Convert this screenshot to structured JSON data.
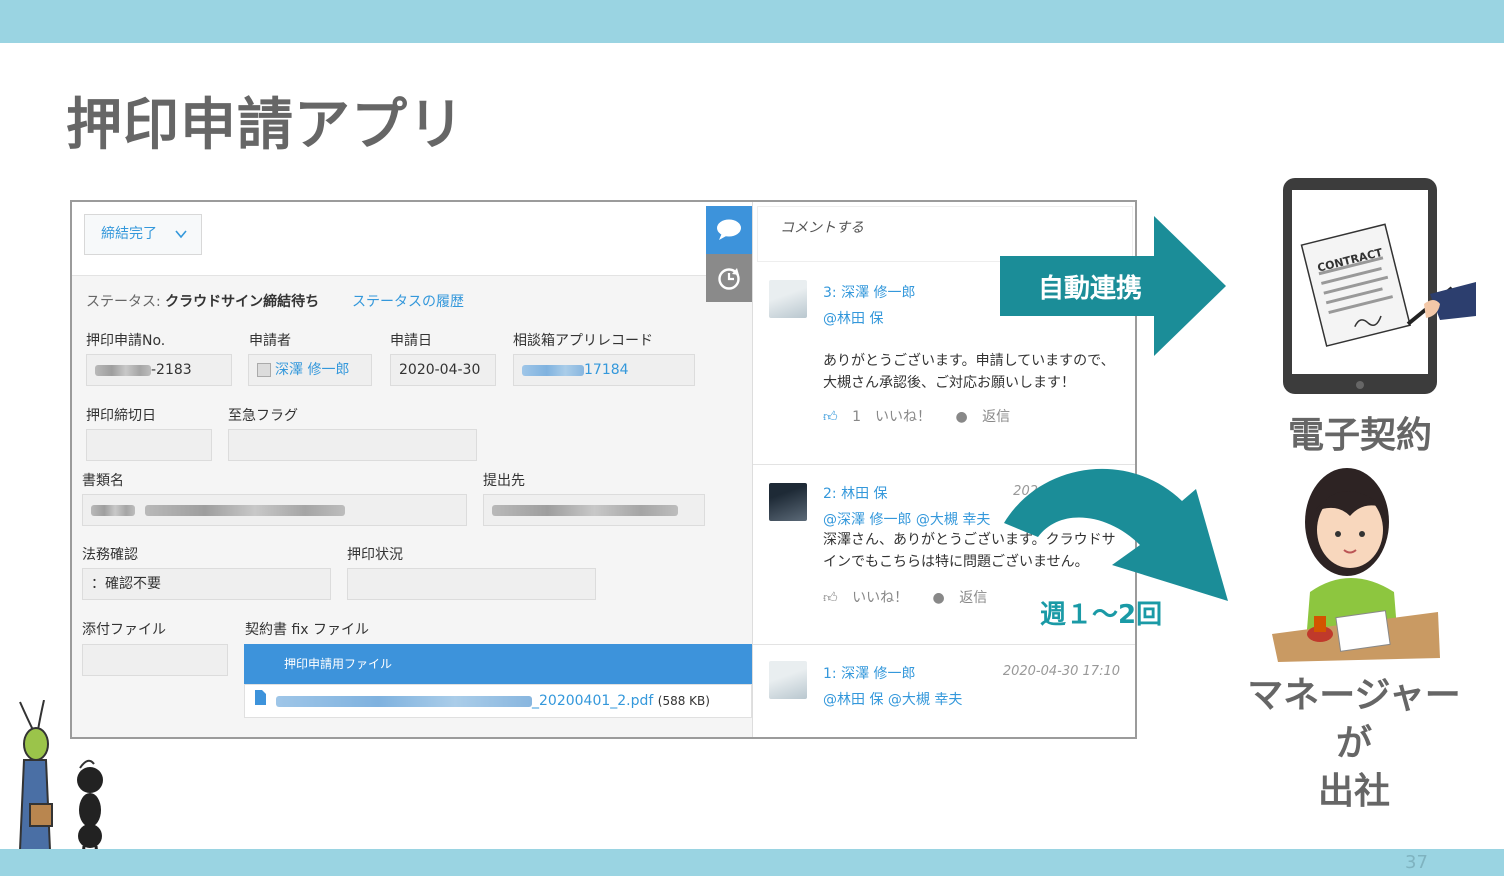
{
  "slide": {
    "title": "押印申請アプリ",
    "page_number": "37"
  },
  "colors": {
    "band": "#9ad4e2",
    "teal": "#1b8d98",
    "link": "#3498db",
    "file_header": "#3d93db"
  },
  "record": {
    "action_button": "締結完了",
    "action_chevron_icon": "chevron-down-icon",
    "status_label": "ステータス: ",
    "status_value": "クラウドサイン締結待ち",
    "status_history_link": "ステータスの履歴",
    "fields": {
      "request_no_label": "押印申請No.",
      "request_no_value": "-2183",
      "applicant_label": "申請者",
      "applicant_value": "深澤 修一郎",
      "apply_date_label": "申請日",
      "apply_date_value": "2020-04-30",
      "consult_record_label": "相談箱アプリレコード",
      "consult_record_value": "17184",
      "deadline_label": "押印締切日",
      "urgent_label": "至急フラグ",
      "doc_name_label": "書類名",
      "submit_to_label": "提出先",
      "legal_label": "法務確認",
      "legal_value": "：確認不要",
      "stamp_status_label": "押印状況",
      "attachment_label": "添付ファイル",
      "contract_fix_label": "契約書 fix ファイル"
    },
    "file_table": {
      "header": "押印申請用ファイル",
      "file_name_suffix": "_20200401_2.pdf",
      "file_size": "(588 KB)"
    }
  },
  "side_tabs": [
    {
      "icon": "comment-icon",
      "active": true
    },
    {
      "icon": "history-icon",
      "active": false
    }
  ],
  "comments": {
    "input_placeholder": "コメントする",
    "items": [
      {
        "name": "3: 深澤 修一郎",
        "mention": "@林田 保",
        "body": "ありがとうございます。申請していますので、大槻さん承認後、ご対応お願いします！",
        "like_label": "1　いいね！",
        "reply_label": "返信"
      },
      {
        "name": "2: 林田 保",
        "date": "202",
        "mention": "@深澤 修一郎 @大槻 幸夫",
        "body": "深澤さん、ありがとうございます。クラウドサインでもこちらは特に問題ございません。",
        "like_label": "いいね！",
        "reply_label": "返信"
      },
      {
        "name": "1: 深澤 修一郎",
        "date": "2020-04-30 17:10",
        "mention": "@林田 保 @大槻 幸夫"
      }
    ]
  },
  "annotations": {
    "auto_link_label": "自動連携",
    "frequency_label": "週１～2回",
    "e_contract_caption": "電子契約",
    "contract_sign_text": "CONTRACT",
    "manager_caption_line1": "マネージャーが",
    "manager_caption_line2": "出社"
  }
}
